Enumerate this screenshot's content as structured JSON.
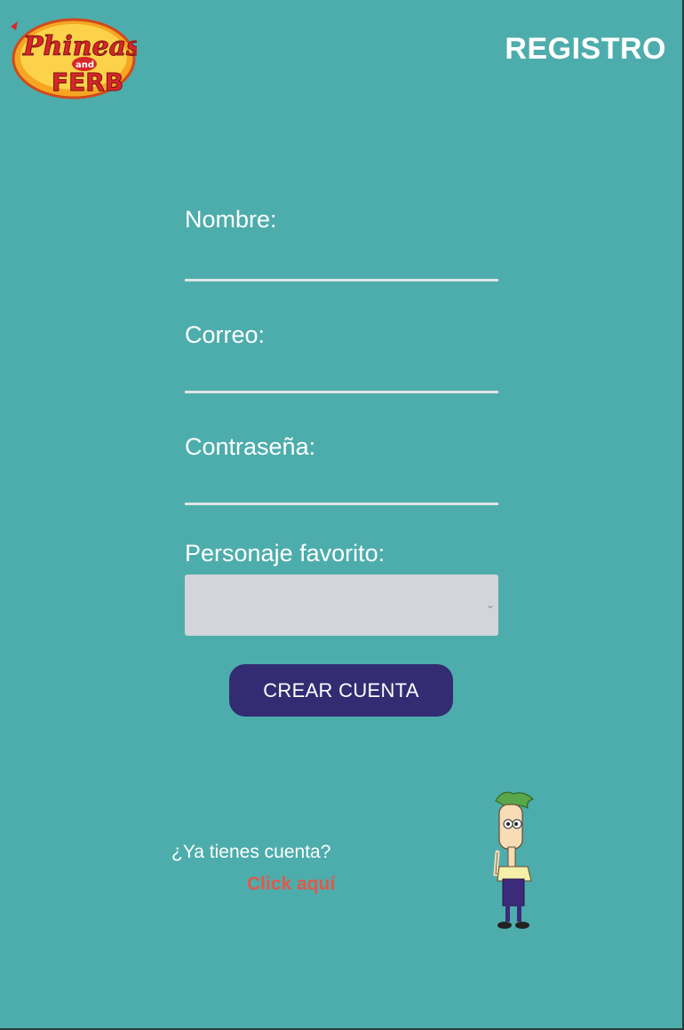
{
  "header": {
    "logo_text_top": "Phineas",
    "logo_text_and": "and",
    "logo_text_bottom": "FERB",
    "title": "REGISTRO"
  },
  "form": {
    "name_label": "Nombre:",
    "name_value": "",
    "email_label": "Correo:",
    "email_value": "",
    "password_label": "Contraseña:",
    "password_value": "",
    "character_label": "Personaje favorito:",
    "character_selected": ""
  },
  "actions": {
    "create_label": "CREAR CUENTA"
  },
  "footer": {
    "question": "¿Ya tienes cuenta?",
    "link_label": "Click aquí"
  },
  "colors": {
    "background": "#4dadac",
    "button": "#332c72",
    "link": "#e2584a",
    "select_bg": "#d3d5da"
  }
}
